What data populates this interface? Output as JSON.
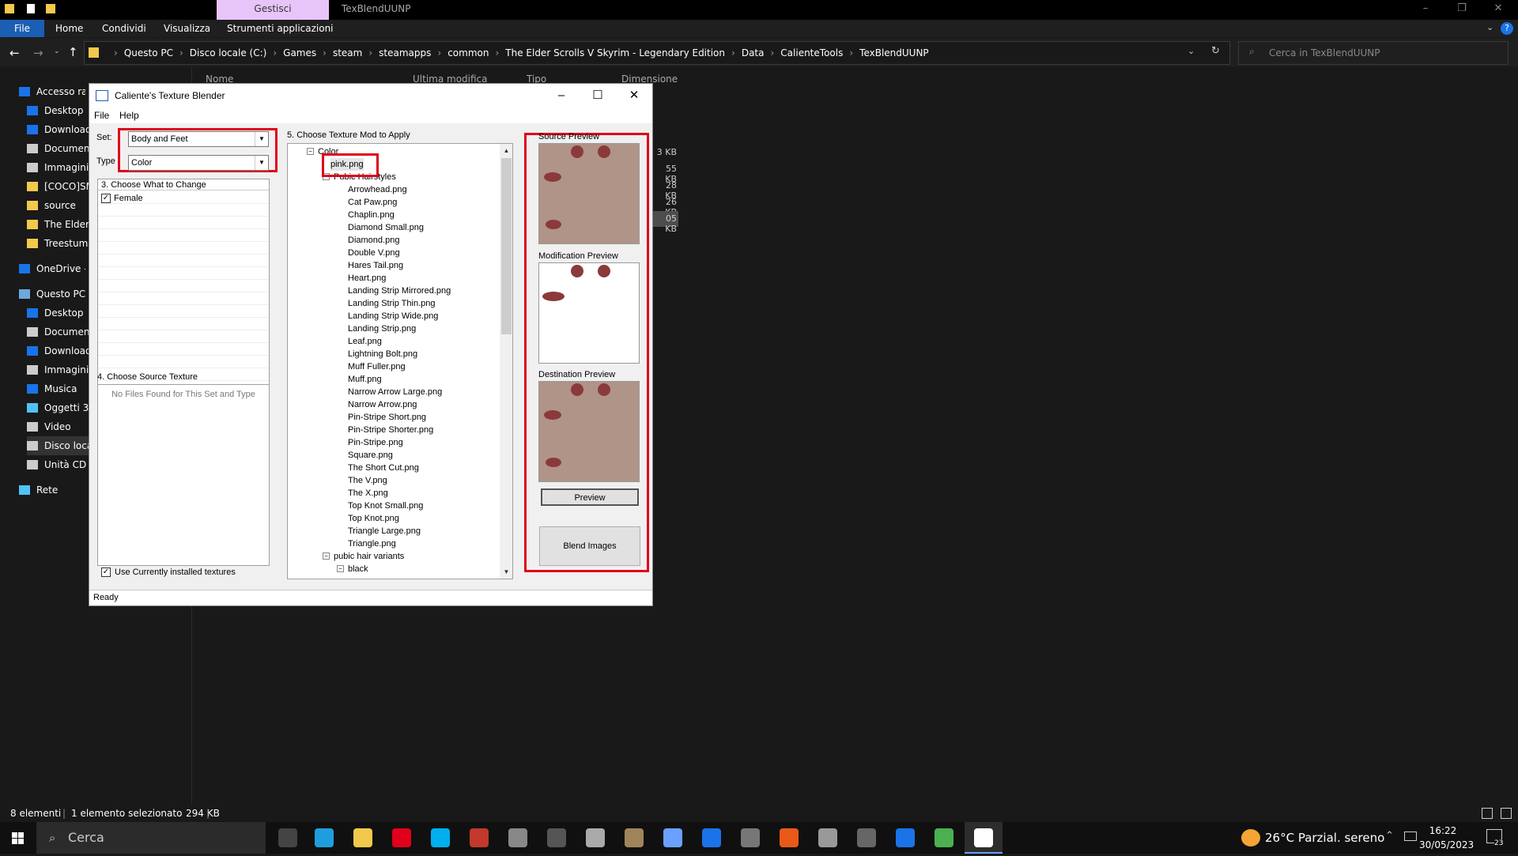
{
  "explorer": {
    "ribbon_context_tab": "Gestisci",
    "window_title": "TexBlendUUNP",
    "ribbon_tabs": [
      "File",
      "Home",
      "Condividi",
      "Visualizza",
      "Strumenti applicazioni"
    ],
    "breadcrumb": [
      "Questo PC",
      "Disco locale (C:)",
      "Games",
      "steam",
      "steamapps",
      "common",
      "The Elder Scrolls V Skyrim - Legendary Edition",
      "Data",
      "CalienteTools",
      "TexBlendUUNP"
    ],
    "search_placeholder": "Cerca in TexBlendUUNP",
    "column_headers": [
      "Nome",
      "Ultima modifica",
      "Tipo",
      "Dimensione"
    ],
    "file_sizes": [
      "3 KB",
      "55 KB",
      "28 KB",
      "26 KB",
      "05 KB"
    ],
    "nav_items": [
      "Accesso rapi",
      "Desktop",
      "Download",
      "Documenti",
      "Immagini",
      "[COCO]SM",
      "source",
      "The Elder S",
      "TreestumpC",
      "OneDrive - P",
      "Questo PC",
      "Desktop",
      "Documenti",
      "Download",
      "Immagini",
      "Musica",
      "Oggetti 3D",
      "Video",
      "Disco local",
      "Unità CD (J",
      "Rete"
    ],
    "status_items": "8 elementi",
    "status_selected": "1 elemento selezionato",
    "status_size": "294 KB"
  },
  "dialog": {
    "title": "Caliente's Texture Blender",
    "menu": [
      "File",
      "Help"
    ],
    "set_label": "Set:",
    "set_value": "Body and Feet",
    "type_label": "Type",
    "type_value": "Color",
    "section3_title": "3. Choose What to Change",
    "female_label": "Female",
    "section4_title": "4. Choose Source Texture",
    "no_files_text": "No Files Found for This Set and Type",
    "use_installed_label": "Use Currently installed textures",
    "section5_title": "5. Choose Texture Mod to Apply",
    "tree": {
      "root": "Color",
      "selected": "pink.png",
      "group1": "Pubic Hairstyles",
      "files": [
        "Arrowhead.png",
        "Cat Paw.png",
        "Chaplin.png",
        "Diamond Small.png",
        "Diamond.png",
        "Double V.png",
        "Hares Tail.png",
        "Heart.png",
        "Landing Strip Mirrored.png",
        "Landing Strip Thin.png",
        "Landing Strip Wide.png",
        "Landing Strip.png",
        "Leaf.png",
        "Lightning Bolt.png",
        "Muff Fuller.png",
        "Muff.png",
        "Narrow Arrow Large.png",
        "Narrow Arrow.png",
        "Pin-Stripe Short.png",
        "Pin-Stripe Shorter.png",
        "Pin-Stripe.png",
        "Square.png",
        "The Short Cut.png",
        "The V.png",
        "The X.png",
        "Top Knot Small.png",
        "Top Knot.png",
        "Triangle Large.png",
        "Triangle.png"
      ],
      "group2": "pubic hair variants",
      "group2_child": "black"
    },
    "source_preview_label": "Source Preview",
    "modification_preview_label": "Modification Preview",
    "destination_preview_label": "Destination Preview",
    "preview_button": "Preview",
    "blend_button": "Blend Images",
    "status": "Ready"
  },
  "taskbar": {
    "search_placeholder": "Cerca",
    "weather": "26°C  Parzial. sereno",
    "time": "16:22",
    "date": "30/05/2023",
    "notification_count": "23"
  }
}
